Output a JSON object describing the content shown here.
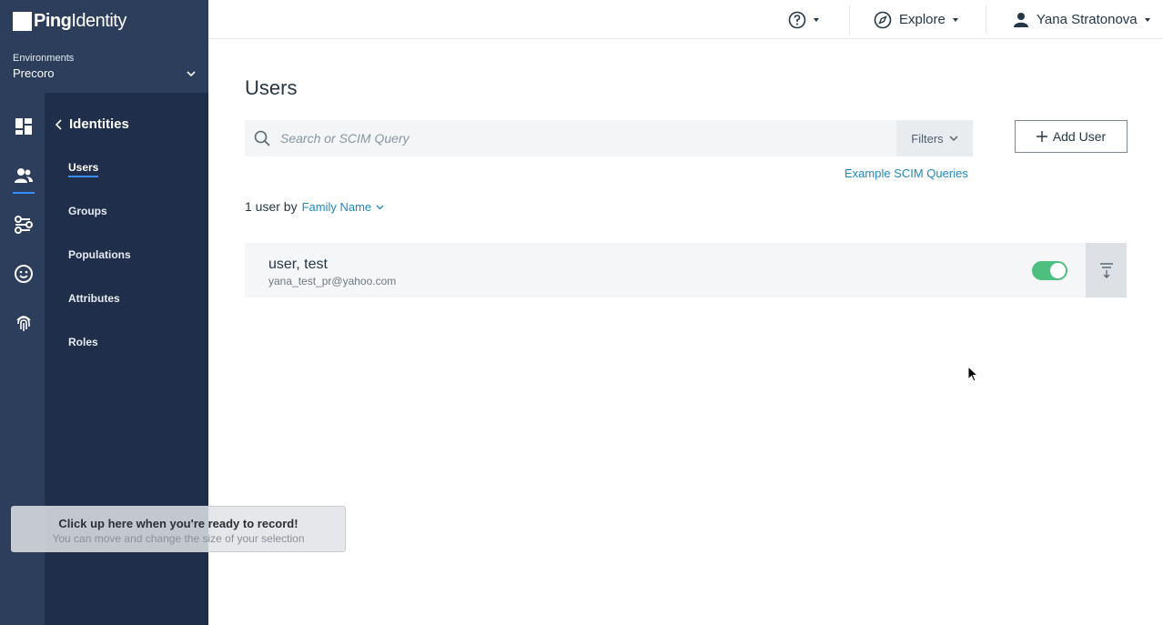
{
  "brand": {
    "logo_bold": "Ping",
    "logo_light": "Identity",
    "env_label": "Environments",
    "env_name": "Precoro"
  },
  "rail": {
    "icons": [
      "dashboard-icon",
      "users-icon",
      "connections-icon",
      "experiences-icon",
      "fingerprint-icon"
    ],
    "active": "users-icon"
  },
  "subnav": {
    "title": "Identities",
    "items": [
      {
        "label": "Users",
        "active": true
      },
      {
        "label": "Groups"
      },
      {
        "label": "Populations"
      },
      {
        "label": "Attributes"
      },
      {
        "label": "Roles"
      }
    ]
  },
  "topbar": {
    "help_icon": "help-circle-icon",
    "explore_label": "Explore",
    "user_name": "Yana Stratonova"
  },
  "main": {
    "title": "Users",
    "search_placeholder": "Search or SCIM Query",
    "filters_label": "Filters",
    "add_user_label": "Add User",
    "scim_link": "Example SCIM Queries",
    "count_text": "1 user by",
    "sort_label": "Family Name",
    "users": [
      {
        "name": "user, test",
        "email": "yana_test_pr@yahoo.com",
        "enabled": true
      }
    ]
  },
  "overlay": {
    "title": "Click up here when you're ready to record!",
    "subtitle": "You can move and change the size of your selection"
  },
  "colors": {
    "nav_bg": "#2c3e5c",
    "subnav_bg": "#1f2e4a",
    "accent": "#3a8cfc",
    "link": "#1f89c2",
    "toggle_on": "#4fbf7f"
  }
}
